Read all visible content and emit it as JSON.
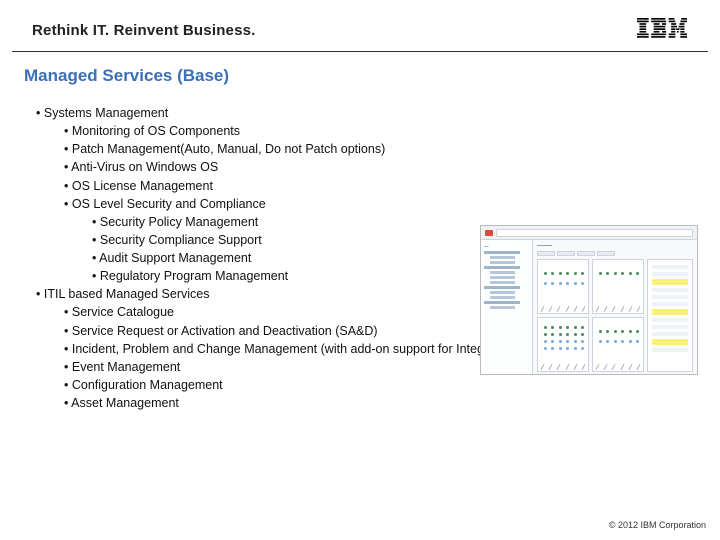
{
  "header": {
    "tagline": "Rethink IT. Reinvent Business.",
    "logo_alt": "IBM"
  },
  "title": "Managed Services (Base)",
  "bullets": {
    "systems_mgmt": "Systems Management",
    "monitoring": "Monitoring of OS Components",
    "patch": "Patch Management(Auto, Manual, Do not Patch options)",
    "antivirus": "Anti-Virus on Windows OS",
    "os_license": "OS License Management",
    "os_security": "OS Level Security and Compliance",
    "sec_policy": "Security Policy Management",
    "sec_compliance": "Security Compliance Support",
    "audit": "Audit Support Management",
    "regulatory": "Regulatory Program Management",
    "itil": "ITIL based Managed Services",
    "catalogue": "Service Catalogue",
    "sad": "Service Request or Activation and Deactivation (SA&D)",
    "incident": "Incident, Problem and Change Management (with add-on support for Integration Services)",
    "event": "Event Management",
    "config": "Configuration Management",
    "asset": "Asset Management"
  },
  "footer": "© 2012 IBM Corporation"
}
